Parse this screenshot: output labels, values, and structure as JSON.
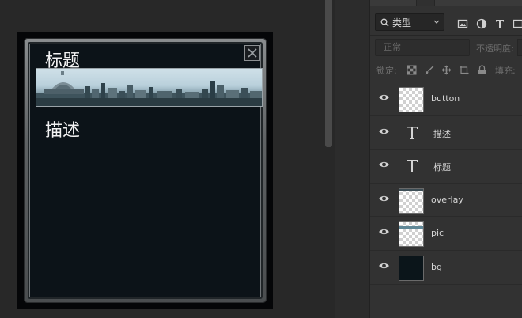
{
  "card": {
    "title": "标题",
    "description": "描述"
  },
  "layers_panel": {
    "filter": {
      "selected": "类型"
    },
    "blend_mode": "正常",
    "opacity_label": "不透明度:",
    "lock_label": "锁定:",
    "fill_label": "填充:",
    "layers": [
      {
        "name": "button",
        "kind": "pixel"
      },
      {
        "name": "描述",
        "kind": "text"
      },
      {
        "name": "标题",
        "kind": "text"
      },
      {
        "name": "overlay",
        "kind": "pixel"
      },
      {
        "name": "pic",
        "kind": "pixel"
      },
      {
        "name": "bg",
        "kind": "pixel"
      }
    ]
  },
  "colors": {
    "canvas_bg": "#282828",
    "panel_bg": "#323232",
    "card_bg": "#0c1318"
  },
  "icons": [
    "search-icon",
    "chevron-down-icon",
    "image-filter-icon",
    "adjustment-filter-icon",
    "text-filter-icon",
    "transparency-lock-icon",
    "brush-lock-icon",
    "move-lock-icon",
    "artboard-lock-icon",
    "lock-icon",
    "eye-icon",
    "close-icon"
  ]
}
